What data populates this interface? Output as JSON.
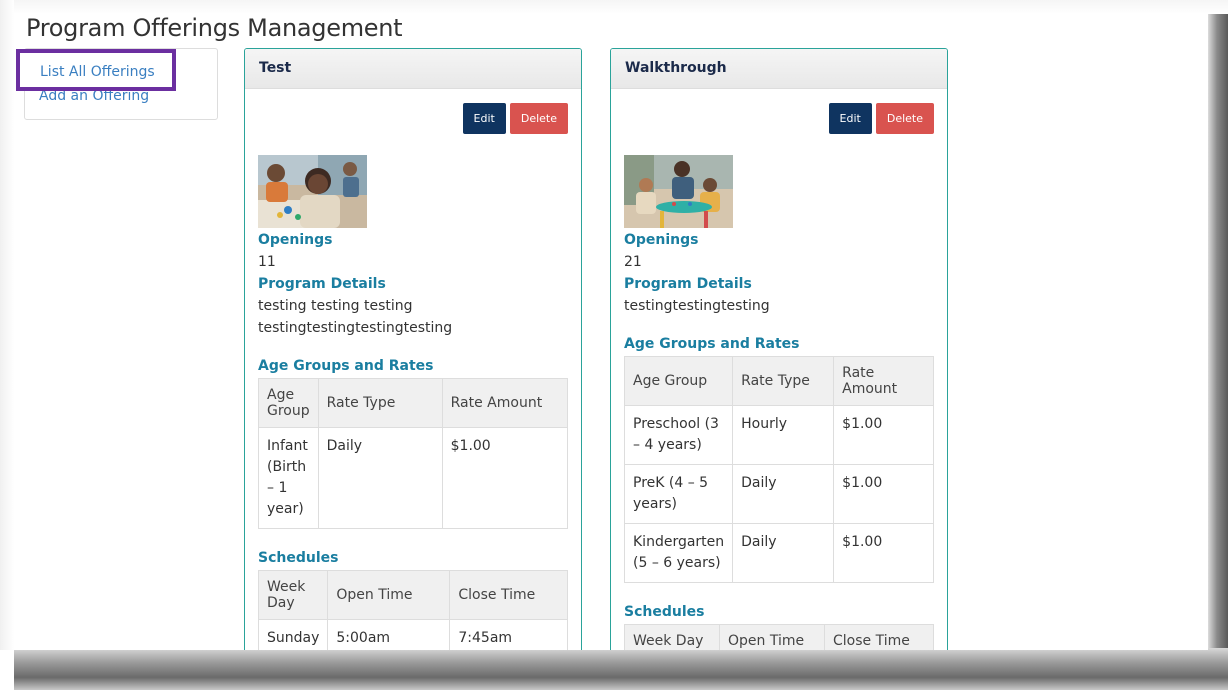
{
  "page": {
    "title": "Program Offerings Management"
  },
  "sidebar": {
    "list_all": "List All Offerings",
    "add_offering": "Add an Offering"
  },
  "offerings": [
    {
      "name": "Test",
      "edit_label": "Edit",
      "delete_label": "Delete",
      "openings_label": "Openings",
      "openings_value": "11",
      "details_label": "Program Details",
      "details_value": "testing testing testing testingtestingtestingtesting",
      "age_groups_label": "Age Groups and Rates",
      "rate_headers": [
        "Age Group",
        "Rate Type",
        "Rate Amount"
      ],
      "rates": [
        [
          "Infant (Birth – 1 year)",
          "Daily",
          "$1.00"
        ]
      ],
      "schedules_label": "Schedules",
      "schedule_headers": [
        "Week Day",
        "Open Time",
        "Close Time"
      ],
      "schedules": [
        [
          "Sunday",
          "5:00am",
          "7:45am"
        ]
      ]
    },
    {
      "name": "Walkthrough",
      "edit_label": "Edit",
      "delete_label": "Delete",
      "openings_label": "Openings",
      "openings_value": "21",
      "details_label": "Program Details",
      "details_value": "testingtestingtesting",
      "age_groups_label": "Age Groups and Rates",
      "rate_headers": [
        "Age Group",
        "Rate Type",
        "Rate Amount"
      ],
      "rates": [
        [
          "Preschool (3 – 4 years)",
          "Hourly",
          "$1.00"
        ],
        [
          "PreK (4 – 5 years)",
          "Daily",
          "$1.00"
        ],
        [
          "Kindergarten (5 – 6 years)",
          "Daily",
          "$1.00"
        ]
      ],
      "schedules_label": "Schedules",
      "schedule_headers": [
        "Week Day",
        "Open Time",
        "Close Time"
      ],
      "schedules": []
    }
  ]
}
